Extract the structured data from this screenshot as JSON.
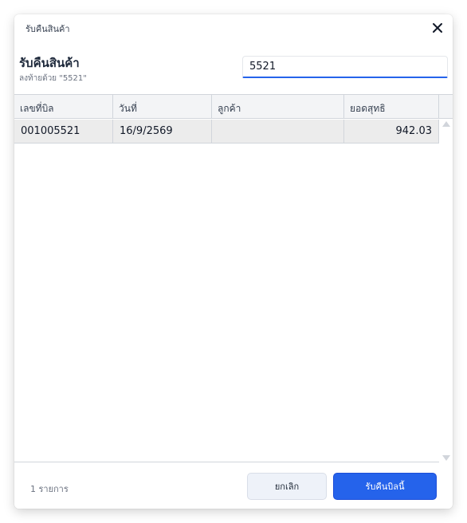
{
  "dialog": {
    "window_title": "รับคืนสินค้า",
    "heading": "รับคืนสินค้า",
    "subheading": "ลงท้ายด้วย \"5521\"",
    "close_icon": "close-icon"
  },
  "search": {
    "value": "5521",
    "placeholder": ""
  },
  "table": {
    "columns": [
      "เลขที่บิล",
      "วันที่",
      "ลูกค้า",
      "ยอดสุทธิ"
    ],
    "rows": [
      {
        "bill_no": "001005521",
        "date": "16/9/2569",
        "customer": "",
        "net_total": "942.03"
      }
    ]
  },
  "footer": {
    "count_text": "1 รายการ",
    "cancel_label": "ยกเลิก",
    "confirm_label": "รับคืนบิลนี้"
  },
  "colors": {
    "accent": "#2563eb",
    "selected_row": "#ececec",
    "header_bg": "#f3f4f6"
  }
}
